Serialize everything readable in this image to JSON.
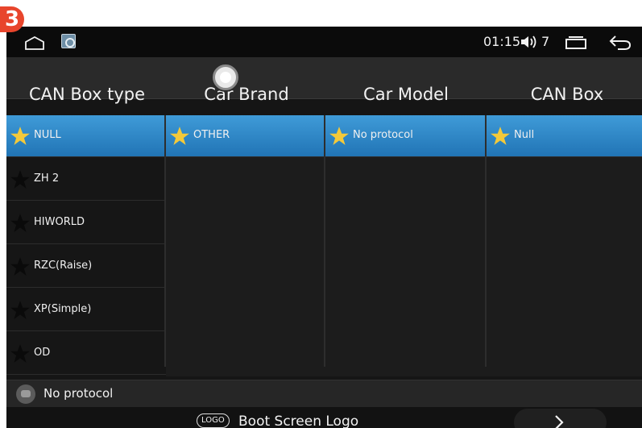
{
  "step_badge": "3",
  "status_bar": {
    "time": "01:15",
    "volume": "7",
    "icons": [
      "home-icon",
      "app-icon",
      "volume-icon",
      "recents-icon",
      "back-icon"
    ]
  },
  "headers": [
    "CAN Box type",
    "Car Brand",
    "Car Model",
    "CAN Box"
  ],
  "columns": {
    "can_box_type": {
      "items": [
        {
          "label": "NULL",
          "selected": true
        },
        {
          "label": "ZH 2",
          "selected": false
        },
        {
          "label": "HIWORLD",
          "selected": false
        },
        {
          "label": "RZC(Raise)",
          "selected": false
        },
        {
          "label": "XP(Simple)",
          "selected": false
        },
        {
          "label": "OD",
          "selected": false
        }
      ]
    },
    "car_brand": {
      "items": [
        {
          "label": "OTHER",
          "selected": true
        }
      ]
    },
    "car_model": {
      "items": [
        {
          "label": "No protocol",
          "selected": true
        }
      ]
    },
    "can_box": {
      "items": [
        {
          "label": "Null",
          "selected": true
        }
      ]
    }
  },
  "footer": {
    "status_text": "No protocol"
  },
  "boot_row": {
    "logo_badge": "LOGO",
    "label": "Boot Screen Logo"
  },
  "colors": {
    "selected_gradient_top": "#3f9bd8",
    "selected_gradient_bottom": "#2174b5",
    "star_selected": "#f3c93a",
    "star_unselected": "#0a0a0a",
    "background": "#151515"
  }
}
